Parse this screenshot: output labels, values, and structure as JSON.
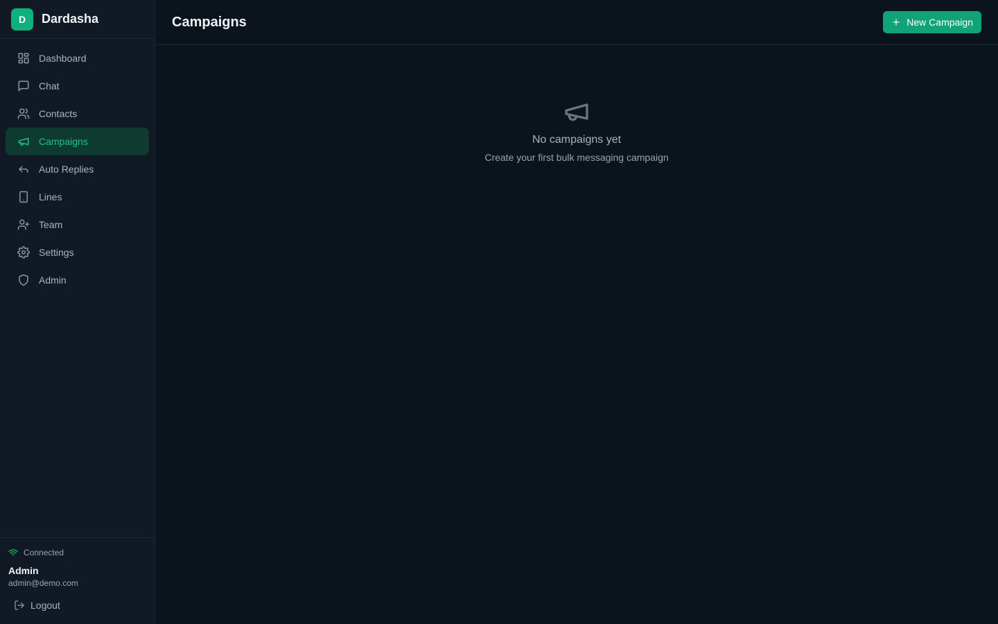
{
  "brand": {
    "logo_letter": "D",
    "name": "Dardasha"
  },
  "sidebar": {
    "items": [
      {
        "label": "Dashboard",
        "icon": "layout-grid-icon"
      },
      {
        "label": "Chat",
        "icon": "message-square-icon"
      },
      {
        "label": "Contacts",
        "icon": "users-icon"
      },
      {
        "label": "Campaigns",
        "icon": "megaphone-icon",
        "active": true
      },
      {
        "label": "Auto Replies",
        "icon": "reply-icon"
      },
      {
        "label": "Lines",
        "icon": "smartphone-icon"
      },
      {
        "label": "Team",
        "icon": "user-plus-icon"
      },
      {
        "label": "Settings",
        "icon": "gear-icon"
      },
      {
        "label": "Admin",
        "icon": "shield-icon"
      }
    ],
    "footer": {
      "status": "Connected",
      "user_name": "Admin",
      "user_email": "admin@demo.com",
      "logout_label": "Logout"
    }
  },
  "header": {
    "title": "Campaigns",
    "new_button_label": "New Campaign"
  },
  "empty_state": {
    "title": "No campaigns yet",
    "subtitle": "Create your first bulk messaging campaign"
  },
  "colors": {
    "accent": "#10a378",
    "active_bg": "#0e3a30",
    "status_green": "#22c55e"
  }
}
